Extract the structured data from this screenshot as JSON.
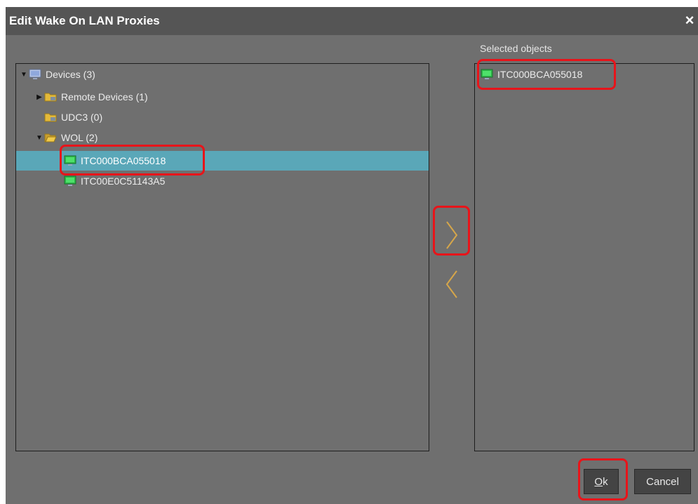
{
  "dialog": {
    "title": "Edit Wake On LAN Proxies",
    "close_glyph": "×"
  },
  "tree": {
    "root": {
      "label": "Devices (3)",
      "icon": "monitor-icon",
      "expanded": true
    },
    "items": [
      {
        "label": "Remote Devices (1)",
        "icon": "folder-icon",
        "expanded": false
      },
      {
        "label": "UDC3 (0)",
        "icon": "folder-icon"
      },
      {
        "label": "WOL (2)",
        "icon": "folder-open-icon",
        "expanded": true
      },
      {
        "label": "ITC000BCA055018",
        "icon": "computer-icon",
        "selected": true
      },
      {
        "label": "ITC00E0C51143A5",
        "icon": "computer-icon"
      }
    ]
  },
  "selected_panel": {
    "label": "Selected objects",
    "items": [
      {
        "label": "ITC000BCA055018",
        "icon": "computer-icon"
      }
    ]
  },
  "transfer": {
    "add_icon": "chevron-right-icon",
    "remove_icon": "chevron-left-icon"
  },
  "buttons": {
    "ok_first": "O",
    "ok_rest": "k",
    "cancel_label": "Cancel"
  },
  "colors": {
    "dialog_bg": "#6f6f6f",
    "title_bg": "#555555",
    "selection": "#5aa7b8",
    "highlight": "#e8141a",
    "arrow": "#d6a64a"
  }
}
